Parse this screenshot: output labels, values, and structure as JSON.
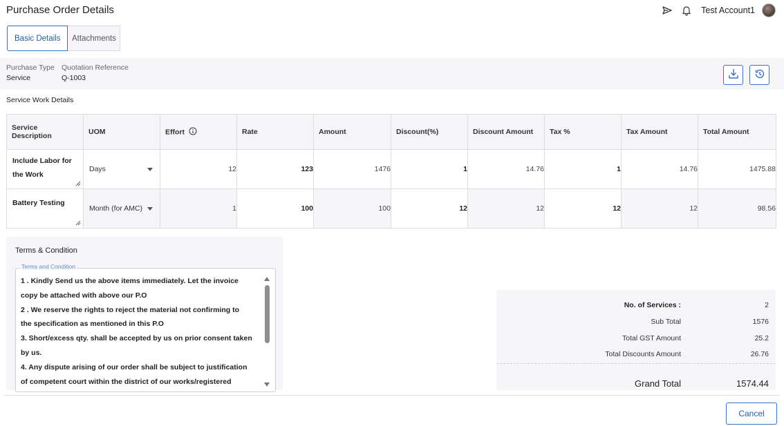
{
  "header": {
    "title": "Purchase Order Details",
    "account_name": "Test Account1"
  },
  "tabs": [
    {
      "label": "Basic Details",
      "active": true
    },
    {
      "label": "Attachments",
      "active": false
    }
  ],
  "info": {
    "purchase_type_label": "Purchase Type",
    "purchase_type_value": "Service",
    "quotation_label": "Quotation Reference",
    "quotation_value": "Q-1003"
  },
  "section_title": "Service Work Details",
  "table": {
    "headers": {
      "description": "Service Description",
      "uom": "UOM",
      "effort": "Effort",
      "rate": "Rate",
      "amount": "Amount",
      "discount_pct": "Discount(%)",
      "discount_amount": "Discount Amount",
      "tax_pct": "Tax %",
      "tax_amount": "Tax Amount",
      "total_amount": "Total Amount"
    },
    "rows": [
      {
        "description": "Include Labor for the Work",
        "uom": "Days",
        "effort": "12",
        "rate": "123",
        "amount": "1476",
        "discount_pct": "1",
        "discount_amount": "14.76",
        "tax_pct": "1",
        "tax_amount": "14.76",
        "total_amount": "1475.88"
      },
      {
        "description": "Battery Testing",
        "uom": "Month (for AMC)",
        "effort": "1",
        "rate": "100",
        "amount": "100",
        "discount_pct": "12",
        "discount_amount": "12",
        "tax_pct": "12",
        "tax_amount": "12",
        "total_amount": "98.56"
      }
    ]
  },
  "terms": {
    "title": "Terms & Condition",
    "field_label": "Terms and Condition",
    "lines": [
      "1 . Kindly Send us the above items immediately. Let the invoice",
      "copy be attached with above our P.O",
      "2 . We reserve the rights to reject the material not confirming to",
      "the specification as mentioned in this P.O",
      "3. Short/excess qty. shall be accepted by us on prior consent taken",
      "by us.",
      "4. Any dispute arising of our order shall be subject to justification",
      "of competent court within the district of our works/registered"
    ]
  },
  "summary": {
    "no_of_services_label": "No. of Services :",
    "no_of_services_value": "2",
    "sub_total_label": "Sub Total",
    "sub_total_value": "1576",
    "gst_label": "Total GST Amount",
    "gst_value": "25.2",
    "discounts_label": "Total Discounts Amount",
    "discounts_value": "26.76",
    "grand_total_label": "Grand Total",
    "grand_total_value": "1574.44"
  },
  "footer": {
    "cancel_label": "Cancel"
  },
  "colors": {
    "accent": "#3b6fc4",
    "panel_bg": "#f6f5f8"
  }
}
